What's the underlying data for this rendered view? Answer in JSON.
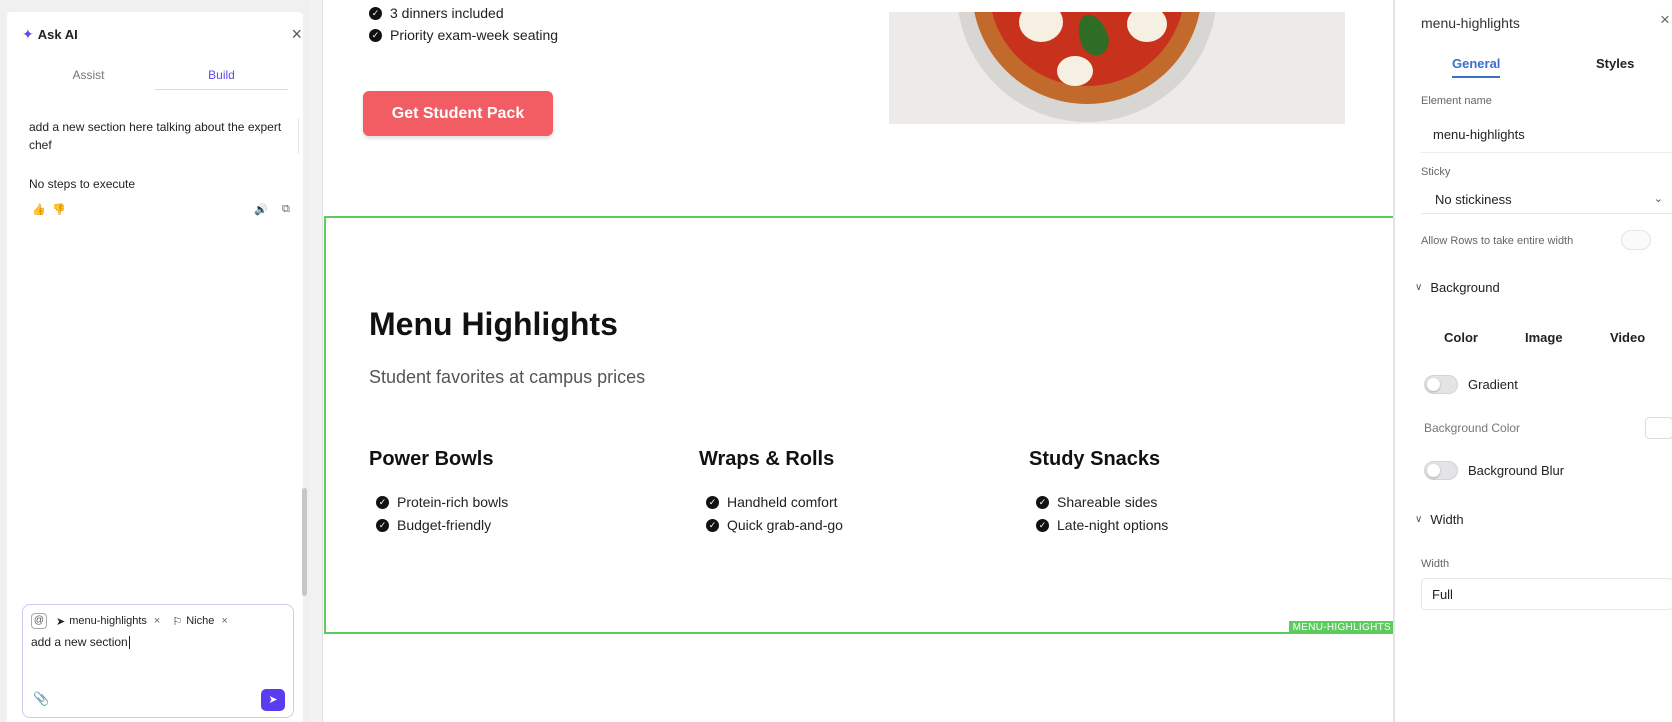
{
  "ai_panel": {
    "title": "Ask AI",
    "tabs": [
      "Assist",
      "Build"
    ],
    "active_tab": "Build",
    "previous_prompt": "add a new section here talking about the expert chef",
    "status": "No steps to execute",
    "composer": {
      "chips": [
        "menu-highlights",
        "Niche"
      ],
      "text": "add a new section"
    }
  },
  "canvas": {
    "features": [
      "3 dinners included",
      "Priority exam-week seating"
    ],
    "cta_label": "Get Student Pack",
    "section": {
      "tag": "MENU-HIGHLIGHTS",
      "title": "Menu Highlights",
      "subtitle": "Student favorites at campus prices",
      "columns": [
        {
          "title": "Power Bowls",
          "items": [
            "Protein-rich bowls",
            "Budget-friendly"
          ]
        },
        {
          "title": "Wraps & Rolls",
          "items": [
            "Handheld comfort",
            "Quick grab-and-go"
          ]
        },
        {
          "title": "Study Snacks",
          "items": [
            "Shareable sides",
            "Late-night options"
          ]
        }
      ]
    }
  },
  "properties": {
    "title": "menu-highlights",
    "tabs": [
      "General",
      "Styles"
    ],
    "active_tab": "General",
    "element_name_label": "Element name",
    "element_name_value": "menu-highlights",
    "sticky_label": "Sticky",
    "sticky_value": "No stickiness",
    "allow_rows_label": "Allow Rows to take entire width",
    "background_heading": "Background",
    "background_tabs": [
      "Color",
      "Image",
      "Video"
    ],
    "gradient_label": "Gradient",
    "background_color_label": "Background Color",
    "background_blur_label": "Background Blur",
    "width_heading": "Width",
    "width_label": "Width",
    "width_value": "Full"
  },
  "colors": {
    "accent": "#5b4cf0",
    "cta": "#f25c63",
    "selection": "#5ecb5e",
    "tab_active": "#3970c9"
  }
}
